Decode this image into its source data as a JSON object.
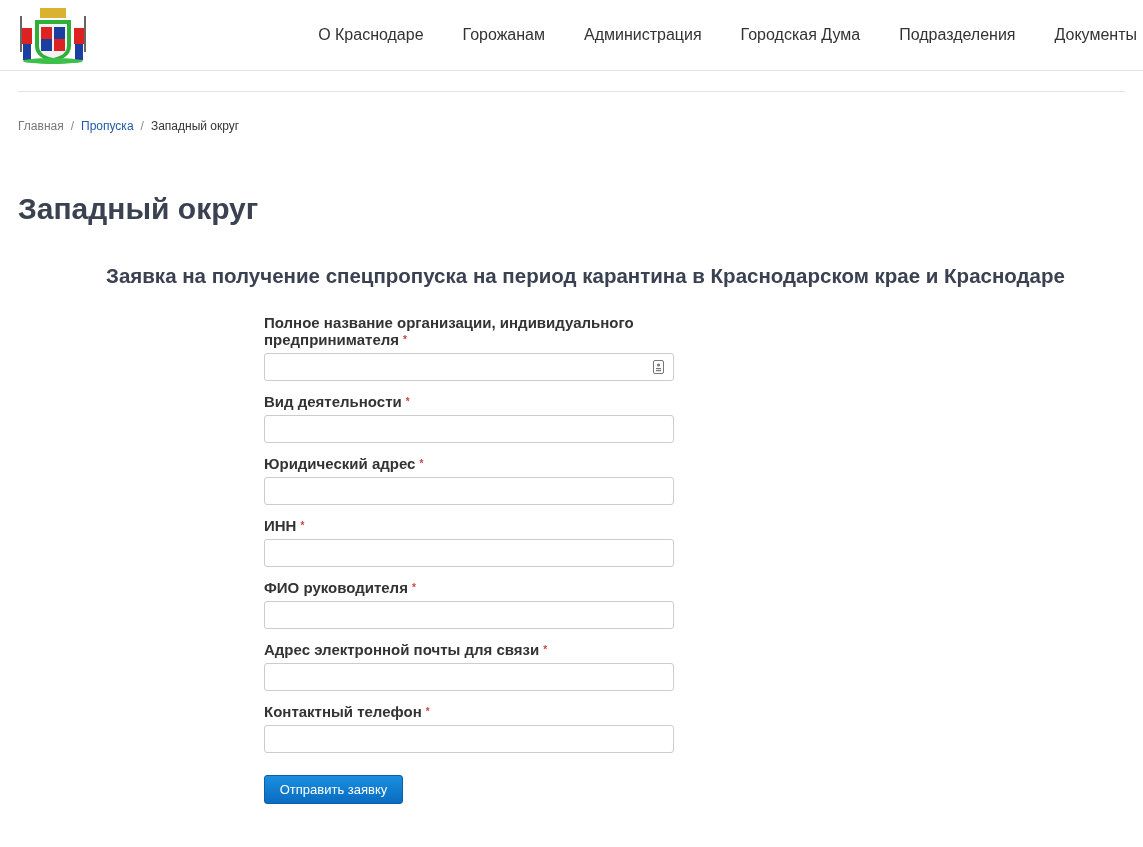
{
  "nav": [
    "О Краснодаре",
    "Горожанам",
    "Администрация",
    "Городская Дума",
    "Подразделения",
    "Документы"
  ],
  "breadcrumbs": [
    {
      "label": "Главная",
      "kind": "muted"
    },
    {
      "label": "Пропуска",
      "kind": "link"
    },
    {
      "label": "Западный округ",
      "kind": "current"
    }
  ],
  "breadcrumb_separator": "/",
  "title": "Западный округ",
  "form_title": "Заявка на получение спецпропуска на период карантина в Краснодарском крае и Краснодаре",
  "fields": [
    {
      "label": "Полное название организации, индивидуального предпринимателя",
      "required_mark": "*",
      "autofill_icon": true
    },
    {
      "label": "Вид деятельности",
      "required_mark": "*",
      "autofill_icon": false
    },
    {
      "label": "Юридический адрес",
      "required_mark": "*",
      "autofill_icon": false
    },
    {
      "label": "ИНН",
      "required_mark": "*",
      "autofill_icon": false
    },
    {
      "label": "ФИО руководителя",
      "required_mark": "*",
      "autofill_icon": false
    },
    {
      "label": "Адрес электронной почты для связи",
      "required_mark": "*",
      "autofill_icon": false
    },
    {
      "label": "Контактный телефон",
      "required_mark": "*",
      "autofill_icon": false
    }
  ],
  "submit": "Отправить заявку"
}
